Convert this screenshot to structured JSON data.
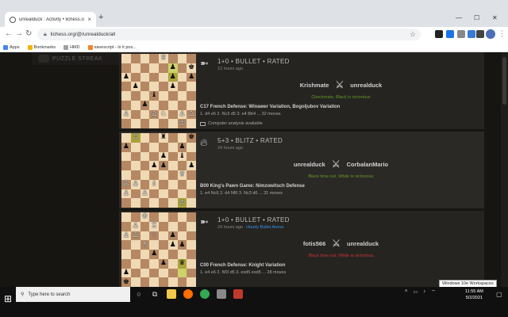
{
  "browser": {
    "tab_title": "unrealduck : Activity • lichess.org",
    "tab_close": "×",
    "new_tab": "+",
    "min": "—",
    "max": "☐",
    "close": "✕",
    "url": "lichess.org/@/unrealduck/all",
    "bookmarks": [
      "Apps",
      "Bookmarks",
      "HMD",
      "savescript - Is it pos..."
    ]
  },
  "sidebar": {
    "puzzle_streak": "PUZZLE STREAK"
  },
  "games": [
    {
      "speed": "1+0 • BULLET • RATED",
      "ago": "12 hours ago",
      "arena": "",
      "white": "Krishmate",
      "black": "unrealduck",
      "result": "Checkmate, Black is victorious",
      "result_color": "green",
      "opening": "C17 French Defense: Winawer Variation, Bogoljubov Variation",
      "moves": "1. d4 e6 2. Nc3 d5 3. e4 Bb4 ... 32 moves",
      "analysis": "Computer analysis available",
      "board": [
        "....Q...",
        ".....p.k",
        "p....p.p",
        ".p...p..",
        "...b....",
        "..p.....",
        "P..PN.PP",
        "......K."
      ],
      "highlight": [
        [
          1,
          5
        ],
        [
          2,
          5
        ]
      ]
    },
    {
      "speed": "5+3 • BLITZ • RATED",
      "ago": "24 hours ago",
      "arena": "",
      "white": "unrealduck",
      "black": "CorbalanMario",
      "result": "Black time out, White is victorious",
      "result_color": "green",
      "opening": "B00 King's Pawn Game: Nimzowitsch Defense",
      "moves": "1. e4 Nc6 2. d4 Nf6 3. Nc3 d6 ... 31 moves",
      "analysis": "",
      "board": [
        ".R..r..k",
        "p.....p.",
        "....p.b.",
        "...pp..p",
        "......Q.",
        "PP.B....",
        "P.P.....",
        "......K."
      ],
      "highlight": [
        [
          0,
          1
        ],
        [
          7,
          6
        ]
      ]
    },
    {
      "speed": "1+0 • BULLET • RATED",
      "ago": "24 hours ago",
      "arena": "Hourly Bullet Arena",
      "white": "fotis566",
      "black": "unrealduck",
      "result": "Black time out, White is victorious",
      "result_color": "red",
      "opening": "C00 French Defense: Knight Variation",
      "moves": "1. e4 e6 2. Nf3 d5 3. exd5 exd5 ... 28 moves",
      "analysis": "",
      "board": [
        "..K.....",
        ".P.R....",
        "PP.N.p..",
        "..B..pp.",
        "...p....",
        "....p.q.",
        "p.......",
        "k.......",
        "........"
      ],
      "highlight": [
        [
          5,
          6
        ],
        [
          6,
          6
        ]
      ]
    }
  ],
  "tooltip": "Windows 10e Workspaces",
  "taskbar": {
    "search_placeholder": "Type here to search",
    "time": "11:55 AM",
    "date": "5/2/2021"
  },
  "colors": {
    "bg": "#161512",
    "green": "#629924",
    "red": "#cc3333",
    "link": "#3692e7"
  }
}
